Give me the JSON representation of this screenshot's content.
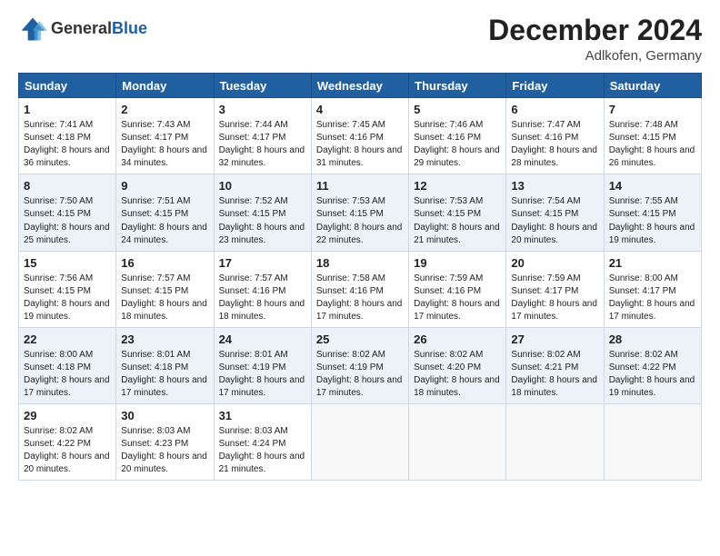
{
  "header": {
    "logo_line1": "General",
    "logo_line2": "Blue",
    "month_title": "December 2024",
    "location": "Adlkofen, Germany"
  },
  "weekdays": [
    "Sunday",
    "Monday",
    "Tuesday",
    "Wednesday",
    "Thursday",
    "Friday",
    "Saturday"
  ],
  "weeks": [
    [
      {
        "day": "1",
        "sunrise": "7:41 AM",
        "sunset": "4:18 PM",
        "daylight": "8 hours and 36 minutes."
      },
      {
        "day": "2",
        "sunrise": "7:43 AM",
        "sunset": "4:17 PM",
        "daylight": "8 hours and 34 minutes."
      },
      {
        "day": "3",
        "sunrise": "7:44 AM",
        "sunset": "4:17 PM",
        "daylight": "8 hours and 32 minutes."
      },
      {
        "day": "4",
        "sunrise": "7:45 AM",
        "sunset": "4:16 PM",
        "daylight": "8 hours and 31 minutes."
      },
      {
        "day": "5",
        "sunrise": "7:46 AM",
        "sunset": "4:16 PM",
        "daylight": "8 hours and 29 minutes."
      },
      {
        "day": "6",
        "sunrise": "7:47 AM",
        "sunset": "4:16 PM",
        "daylight": "8 hours and 28 minutes."
      },
      {
        "day": "7",
        "sunrise": "7:48 AM",
        "sunset": "4:15 PM",
        "daylight": "8 hours and 26 minutes."
      }
    ],
    [
      {
        "day": "8",
        "sunrise": "7:50 AM",
        "sunset": "4:15 PM",
        "daylight": "8 hours and 25 minutes."
      },
      {
        "day": "9",
        "sunrise": "7:51 AM",
        "sunset": "4:15 PM",
        "daylight": "8 hours and 24 minutes."
      },
      {
        "day": "10",
        "sunrise": "7:52 AM",
        "sunset": "4:15 PM",
        "daylight": "8 hours and 23 minutes."
      },
      {
        "day": "11",
        "sunrise": "7:53 AM",
        "sunset": "4:15 PM",
        "daylight": "8 hours and 22 minutes."
      },
      {
        "day": "12",
        "sunrise": "7:53 AM",
        "sunset": "4:15 PM",
        "daylight": "8 hours and 21 minutes."
      },
      {
        "day": "13",
        "sunrise": "7:54 AM",
        "sunset": "4:15 PM",
        "daylight": "8 hours and 20 minutes."
      },
      {
        "day": "14",
        "sunrise": "7:55 AM",
        "sunset": "4:15 PM",
        "daylight": "8 hours and 19 minutes."
      }
    ],
    [
      {
        "day": "15",
        "sunrise": "7:56 AM",
        "sunset": "4:15 PM",
        "daylight": "8 hours and 19 minutes."
      },
      {
        "day": "16",
        "sunrise": "7:57 AM",
        "sunset": "4:15 PM",
        "daylight": "8 hours and 18 minutes."
      },
      {
        "day": "17",
        "sunrise": "7:57 AM",
        "sunset": "4:16 PM",
        "daylight": "8 hours and 18 minutes."
      },
      {
        "day": "18",
        "sunrise": "7:58 AM",
        "sunset": "4:16 PM",
        "daylight": "8 hours and 17 minutes."
      },
      {
        "day": "19",
        "sunrise": "7:59 AM",
        "sunset": "4:16 PM",
        "daylight": "8 hours and 17 minutes."
      },
      {
        "day": "20",
        "sunrise": "7:59 AM",
        "sunset": "4:17 PM",
        "daylight": "8 hours and 17 minutes."
      },
      {
        "day": "21",
        "sunrise": "8:00 AM",
        "sunset": "4:17 PM",
        "daylight": "8 hours and 17 minutes."
      }
    ],
    [
      {
        "day": "22",
        "sunrise": "8:00 AM",
        "sunset": "4:18 PM",
        "daylight": "8 hours and 17 minutes."
      },
      {
        "day": "23",
        "sunrise": "8:01 AM",
        "sunset": "4:18 PM",
        "daylight": "8 hours and 17 minutes."
      },
      {
        "day": "24",
        "sunrise": "8:01 AM",
        "sunset": "4:19 PM",
        "daylight": "8 hours and 17 minutes."
      },
      {
        "day": "25",
        "sunrise": "8:02 AM",
        "sunset": "4:19 PM",
        "daylight": "8 hours and 17 minutes."
      },
      {
        "day": "26",
        "sunrise": "8:02 AM",
        "sunset": "4:20 PM",
        "daylight": "8 hours and 18 minutes."
      },
      {
        "day": "27",
        "sunrise": "8:02 AM",
        "sunset": "4:21 PM",
        "daylight": "8 hours and 18 minutes."
      },
      {
        "day": "28",
        "sunrise": "8:02 AM",
        "sunset": "4:22 PM",
        "daylight": "8 hours and 19 minutes."
      }
    ],
    [
      {
        "day": "29",
        "sunrise": "8:02 AM",
        "sunset": "4:22 PM",
        "daylight": "8 hours and 20 minutes."
      },
      {
        "day": "30",
        "sunrise": "8:03 AM",
        "sunset": "4:23 PM",
        "daylight": "8 hours and 20 minutes."
      },
      {
        "day": "31",
        "sunrise": "8:03 AM",
        "sunset": "4:24 PM",
        "daylight": "8 hours and 21 minutes."
      },
      null,
      null,
      null,
      null
    ]
  ],
  "labels": {
    "sunrise": "Sunrise:",
    "sunset": "Sunset:",
    "daylight": "Daylight:"
  }
}
